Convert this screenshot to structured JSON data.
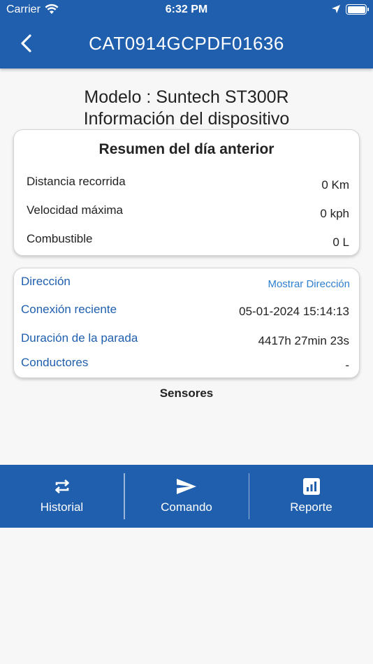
{
  "status_bar": {
    "carrier": "Carrier",
    "time": "6:32 PM"
  },
  "header": {
    "title": "CAT0914GCPDF01636"
  },
  "device": {
    "model_line": "Modelo : Suntech ST300R",
    "info_line": "Información del dispositivo"
  },
  "summary": {
    "title": "Resumen del día anterior",
    "rows": [
      {
        "label": "Distancia recorrida",
        "value": "0 Km"
      },
      {
        "label": "Velocidad máxima",
        "value": "0 kph"
      },
      {
        "label": "Combustible",
        "value": "0 L"
      }
    ]
  },
  "details": {
    "direccion_label": "Dirección",
    "direccion_link": "Mostrar Dirección",
    "conexion_label": "Conexión reciente",
    "conexion_value": "05-01-2024 15:14:13",
    "duracion_label": "Duración de la parada",
    "duracion_value": "4417h 27min 23s",
    "conductores_label": "Conductores",
    "conductores_value": "-"
  },
  "sensors_title": "Sensores",
  "tabbar": [
    {
      "label": "Historial",
      "icon": "repeat-icon"
    },
    {
      "label": "Comando",
      "icon": "send-icon"
    },
    {
      "label": "Reporte",
      "icon": "report-chart-icon"
    }
  ],
  "colors": {
    "primary": "#1f5fae",
    "link": "#2f7fd0",
    "background": "#f7f7f7"
  }
}
